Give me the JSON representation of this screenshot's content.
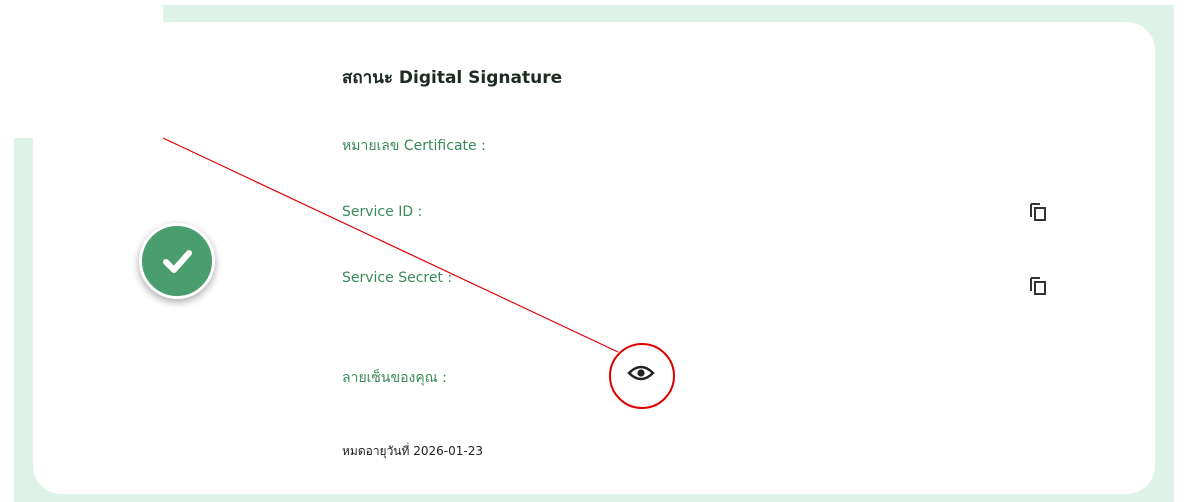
{
  "status_card": {
    "title": "สถานะ Digital Signature",
    "certificate_label": "หมายเลข Certificate :",
    "service_id_label": "Service ID :",
    "service_secret_label": "Service Secret :",
    "signature_label": "ลายเซ็นของคุณ :",
    "expiry_text": "หมดอายุวันที่ 2026-01-23",
    "status_icon": "check-icon",
    "copy_icon": "copy-icon",
    "view_icon": "eye-icon"
  },
  "colors": {
    "accent_green": "#3b8a5a",
    "badge_green": "#4a9d6e",
    "panel_background": "#dff2e8",
    "annotation_red": "#e00000"
  }
}
